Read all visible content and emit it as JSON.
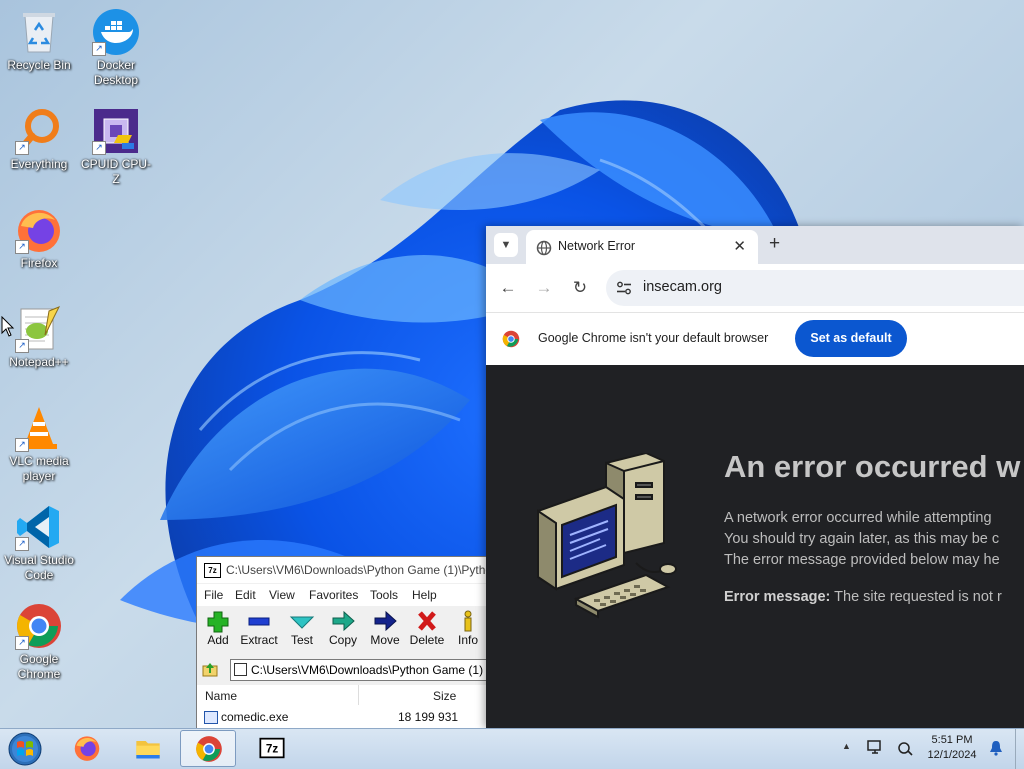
{
  "desktop": {
    "icons": [
      {
        "label_1": "Recycle Bin",
        "label_2": "",
        "icon": "recycle-bin-icon"
      },
      {
        "label_1": "Docker",
        "label_2": "Desktop",
        "icon": "docker-icon"
      },
      {
        "label_1": "Everything",
        "label_2": "",
        "icon": "everything-search-icon"
      },
      {
        "label_1": "CPUID CPU-Z",
        "label_2": "",
        "icon": "cpu-z-icon"
      },
      {
        "label_1": "Firefox",
        "label_2": "",
        "icon": "firefox-icon"
      },
      {
        "label_1": "Notepad++",
        "label_2": "",
        "icon": "notepadpp-icon"
      },
      {
        "label_1": "VLC media",
        "label_2": "player",
        "icon": "vlc-icon"
      },
      {
        "label_1": "Visual Studio",
        "label_2": "Code",
        "icon": "vscode-icon"
      },
      {
        "label_1": "Google",
        "label_2": "Chrome",
        "icon": "chrome-icon"
      }
    ]
  },
  "chrome": {
    "tab_title": "Network Error",
    "url": "insecam.org",
    "infobar_text": "Google Chrome isn't your default browser",
    "set_default_label": "Set as default",
    "error": {
      "heading": "An error occurred w",
      "line_1": "A network error occurred while attempting",
      "line_2": "You should try again later, as this may be c",
      "line_3": "The error message provided below may he",
      "message_label": "Error message:",
      "message_text": "The site requested is not r"
    },
    "colors": {
      "accent": "#0b57d0",
      "page_bg": "#202124",
      "tabstrip": "#dfe3eb"
    }
  },
  "sevenzip": {
    "title": "C:\\Users\\VM6\\Downloads\\Python Game (1)\\Pytho",
    "menu": [
      "File",
      "Edit",
      "View",
      "Favorites",
      "Tools",
      "Help"
    ],
    "toolbar": [
      "Add",
      "Extract",
      "Test",
      "Copy",
      "Move",
      "Delete",
      "Info"
    ],
    "path": "C:\\Users\\VM6\\Downloads\\Python Game (1)",
    "columns": {
      "name": "Name",
      "size": "Size"
    },
    "files": [
      {
        "name": "comedic.exe",
        "size": "18 199 931"
      }
    ]
  },
  "taskbar": {
    "time": "5:51 PM",
    "date": "12/1/2024",
    "pinned": [
      "start-orb",
      "firefox-icon",
      "file-explorer-icon",
      "chrome-icon",
      "7zip-icon"
    ]
  }
}
